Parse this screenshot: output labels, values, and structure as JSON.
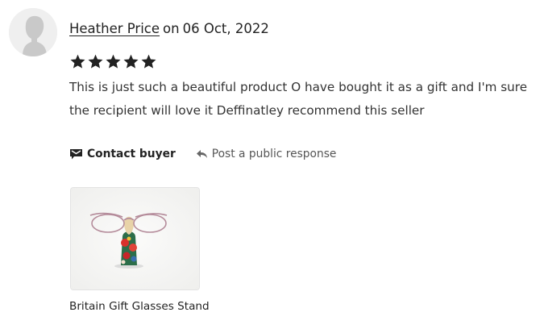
{
  "review": {
    "reviewer_name": "Heather Price",
    "on_word": "on",
    "date": "06 Oct, 2022",
    "rating": 5,
    "rating_max": 5,
    "text": "This is just such a beautiful product O have bought it as a gift and I'm sure the recipient will love it Deffinatley recommend this seller"
  },
  "actions": {
    "contact_label": "Contact buyer",
    "contact_icon": "message-icon",
    "post_label": "Post a public response",
    "post_icon": "reply-arrow-icon"
  },
  "product": {
    "title": "Britain Gift Glasses Stand",
    "image": "glasses-stand-photo"
  },
  "colors": {
    "text": "#222222",
    "star": "#222222",
    "muted": "#555555"
  }
}
